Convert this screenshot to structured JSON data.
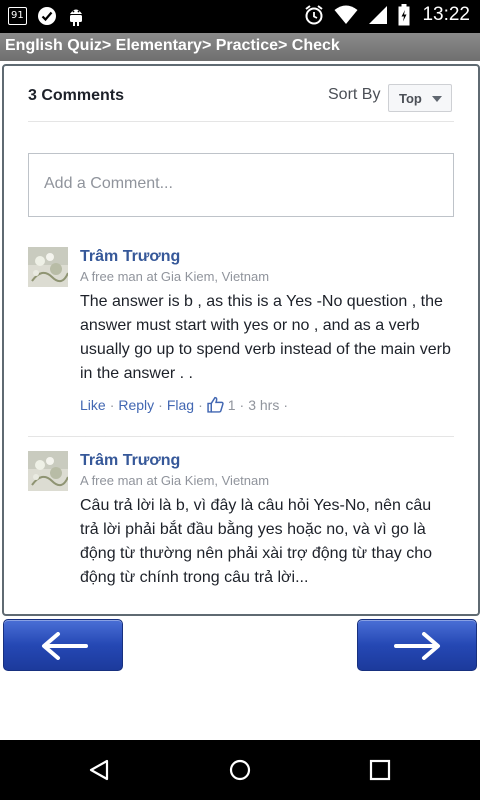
{
  "status_bar": {
    "notification_badge": "91",
    "time": "13:22"
  },
  "title_bar": {
    "breadcrumb": "English Quiz> Elementary> Practice> Check"
  },
  "comments": {
    "count_label": "3 Comments",
    "sort_label": "Sort By",
    "sort_value": "Top",
    "input_placeholder": "Add a Comment...",
    "items": [
      {
        "author": "Trâm Trương",
        "meta": "A free man at Gia Kiem, Vietnam",
        "text": "The answer is b , as this is a Yes -No question , the answer must start with yes or no , and as a verb usually go up to spend verb instead of the main verb in the answer . .",
        "like": "Like",
        "reply": "Reply",
        "flag": "Flag",
        "likes_count": "1",
        "time": "3 hrs"
      },
      {
        "author": "Trâm Trương",
        "meta": "A free man at Gia Kiem, Vietnam",
        "text": "Câu trả lời là b, vì đây là câu hỏi Yes-No, nên câu trả lời phải bắt đầu bằng yes hoặc no, và vì go là động từ thường nên phải xài trợ động từ thay cho động từ chính trong câu trả lời..."
      }
    ]
  },
  "colors": {
    "link": "#365899",
    "nav_button": "#2548b4",
    "title_bar": "#7d7d7d"
  }
}
